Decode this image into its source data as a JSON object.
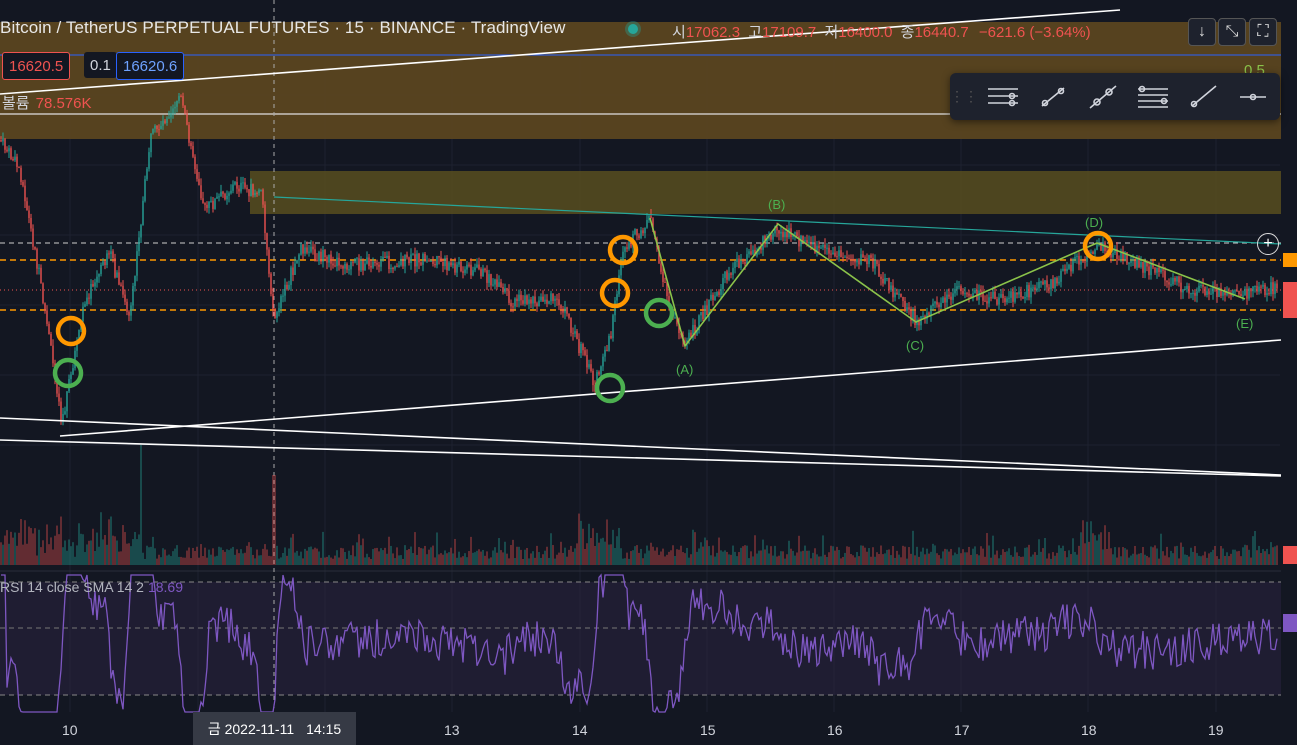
{
  "header": {
    "title": "Bitcoin / TetherUS PERPETUAL FUTURES · 15 · BINANCE · TradingView",
    "ohlc": {
      "open_label": "시",
      "open": "17062.3",
      "high_label": "고",
      "high": "17109.7",
      "low_label": "저",
      "low": "16400.0",
      "close_label": "종",
      "close": "16440.7",
      "change": "−621.6 (−3.64%)"
    },
    "buttons": {
      "down_arrow": "↓",
      "collapse": "⤡",
      "fullscreen": "⛶"
    }
  },
  "price_boxes": {
    "sell": "16620.5",
    "spread": "0.1",
    "buy": "16620.6"
  },
  "volume": {
    "label": "볼륨",
    "value": "78.576K"
  },
  "fib_label": "0.5",
  "toolbar": {
    "items": [
      "horizontal-ray-tool",
      "trend-line-tool",
      "extended-line-tool",
      "fib-retracement-tool",
      "ray-tool",
      "horizontal-line-tool"
    ]
  },
  "waves": {
    "a": "(A)",
    "b": "(B)",
    "c": "(C)",
    "d": "(D)",
    "e": "(E)"
  },
  "rsi": {
    "label": "RSI 14 close SMA 14 2",
    "value": "18.69"
  },
  "time_axis": {
    "ticks": [
      "10",
      "13",
      "14",
      "15",
      "16",
      "17",
      "18",
      "19"
    ],
    "crosshair_date": "금 2022-11-11",
    "crosshair_time": "14:15"
  },
  "colors": {
    "background": "#131722",
    "up": "#26a69a",
    "down": "#ef5350",
    "zone": "#5a4520",
    "wave": "#4caf50",
    "orange": "#ff9800",
    "rsi": "#7e57c2"
  }
}
